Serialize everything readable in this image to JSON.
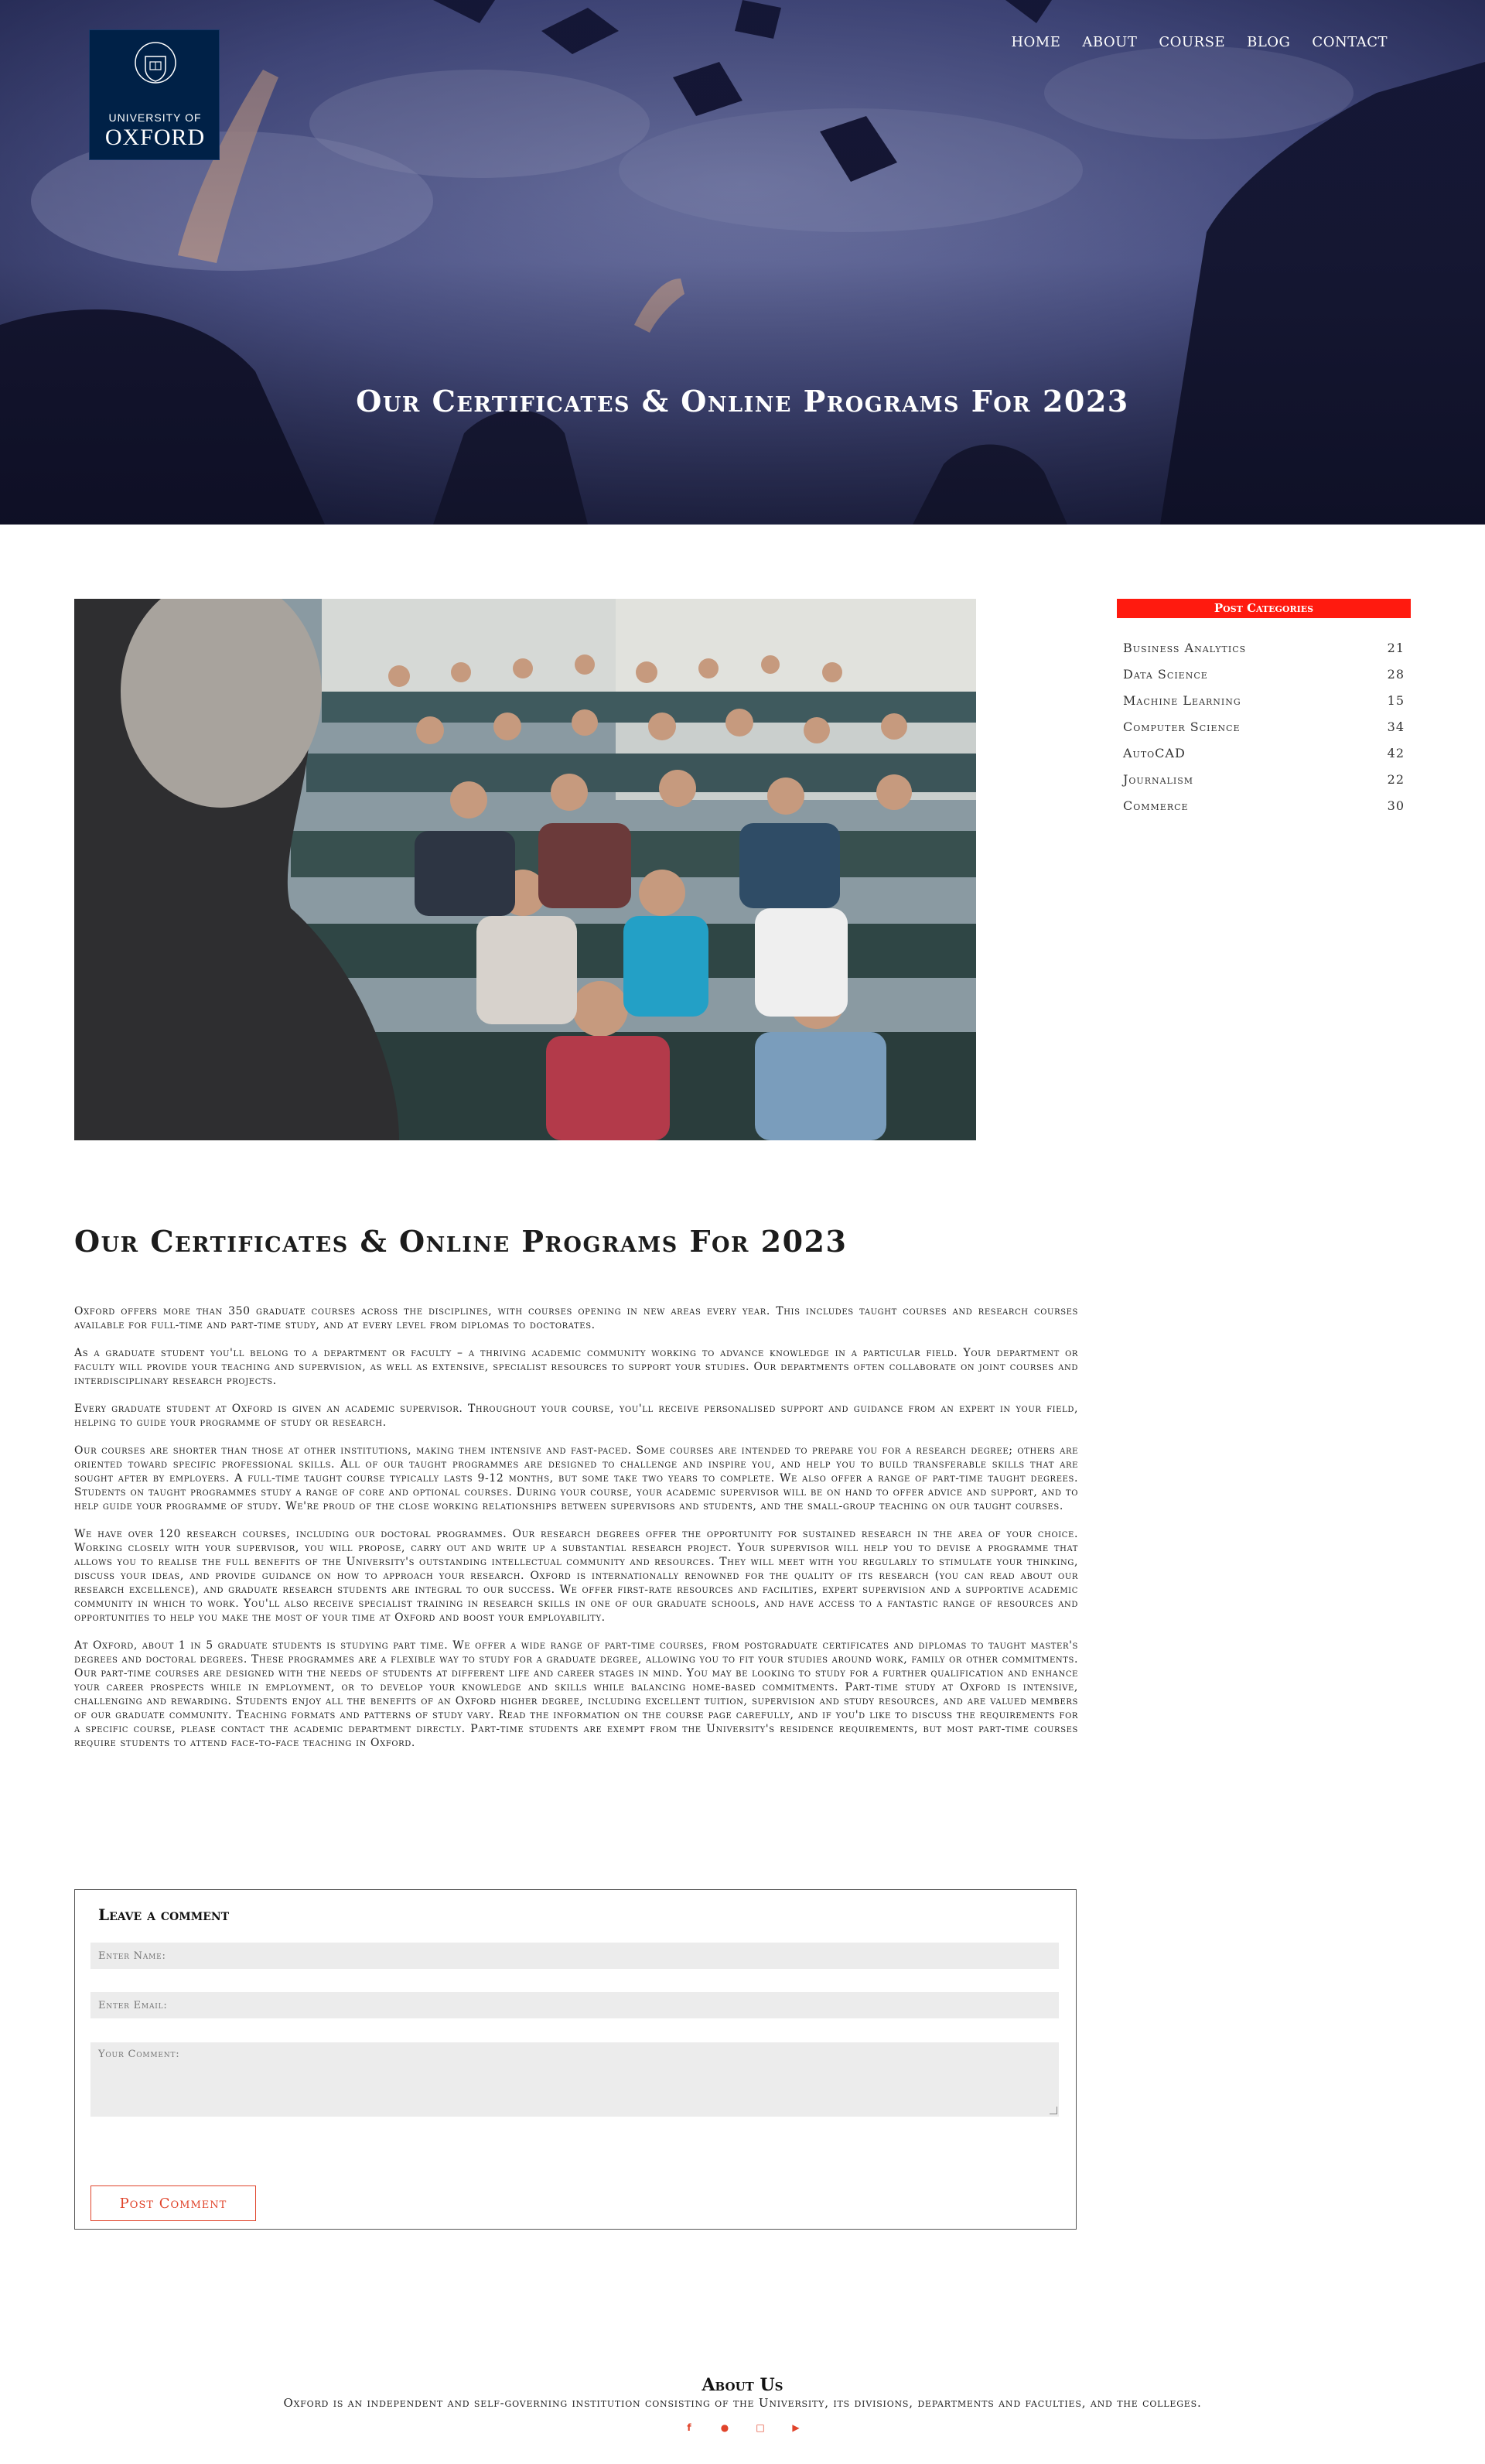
{
  "logo": {
    "line1": "UNIVERSITY OF",
    "line2": "OXFORD"
  },
  "nav": {
    "items": [
      {
        "label": "HOME"
      },
      {
        "label": "ABOUT"
      },
      {
        "label": "COURSE"
      },
      {
        "label": "BLOG"
      },
      {
        "label": "CONTACT"
      }
    ]
  },
  "hero": {
    "title": "Our Certificates & Online Programs For 2023"
  },
  "article": {
    "title": "Our Certificates & Online Programs For 2023",
    "paragraphs": [
      "Oxford offers more than 350 graduate courses across the disciplines, with courses opening in new areas every year. This includes taught courses and research courses available for full-time and part-time study, and at every level from diplomas to doctorates.",
      "As a graduate student you'll belong to a department or faculty – a thriving academic community working to advance knowledge in a particular field. Your department or faculty will provide your teaching and supervision, as well as extensive, specialist resources to support your studies. Our departments often collaborate on joint courses and interdisciplinary research projects.",
      "Every graduate student at Oxford is given an academic supervisor. Throughout your course, you'll receive personalised support and guidance from an expert in your field, helping to guide your programme of study or research.",
      "Our courses are shorter than those at other institutions, making them intensive and fast-paced. Some courses are intended to prepare you for a research degree; others are oriented toward specific professional skills. All of our taught programmes are designed to challenge and inspire you, and help you to build transferable skills that are sought after by employers. A full-time taught course typically lasts 9-12 months, but some take two years to complete. We also offer a range of part-time taught degrees. Students on taught programmes study a range of core and optional courses. During your course, your academic supervisor will be on hand to offer advice and support, and to help guide your programme of study. We're proud of the close working relationships between supervisors and students, and the small-group teaching on our taught courses.",
      "We have over 120 research courses, including our doctoral programmes. Our research degrees offer the opportunity for sustained research in the area of your choice. Working closely with your supervisor, you will propose, carry out and write up a substantial research project. Your supervisor will help you to devise a programme that allows you to realise the full benefits of the University's outstanding intellectual community and resources. They will meet with you regularly to stimulate your thinking, discuss your ideas, and provide guidance on how to approach your research. Oxford is internationally renowned for the quality of its research (you can read about our research excellence), and graduate research students are integral to our success. We offer first-rate resources and facilities, expert supervision and a supportive academic community in which to work. You'll also receive specialist training in research skills in one of our graduate schools, and have access to a fantastic range of resources and opportunities to help you make the most of your time at Oxford and boost your employability.",
      "At Oxford, about 1 in 5 graduate students is studying part time. We offer a wide range of part-time courses, from postgraduate certificates and diplomas to taught master's degrees and doctoral degrees. These programmes are a flexible way to study for a graduate degree, allowing you to fit your studies around work, family or other commitments. Our part-time courses are designed with the needs of students at different life and career stages in mind. You may be looking to study for a further qualification and enhance your career prospects while in employment, or to develop your knowledge and skills while balancing home-based commitments. Part-time study at Oxford is intensive, challenging and rewarding. Students enjoy all the benefits of an Oxford higher degree, including excellent tuition, supervision and study resources, and are valued members of our graduate community. Teaching formats and patterns of study vary. Read the information on the course page carefully, and if you'd like to discuss the requirements for a specific course, please contact the academic department directly. Part-time students are exempt from the University's residence requirements, but most part-time courses require students to attend face-to-face teaching in Oxford."
    ]
  },
  "sidebar": {
    "header": "Post Categories",
    "categories": [
      {
        "name": "Business Analytics",
        "count": "21"
      },
      {
        "name": "Data Science",
        "count": "28"
      },
      {
        "name": "Machine Learning",
        "count": "15"
      },
      {
        "name": "Computer Science",
        "count": "34"
      },
      {
        "name": "AutoCAD",
        "count": "42"
      },
      {
        "name": "Journalism",
        "count": "22"
      },
      {
        "name": "Commerce",
        "count": "30"
      }
    ]
  },
  "comment": {
    "title": "Leave a comment",
    "name_placeholder": "Enter Name:",
    "email_placeholder": "Enter Email:",
    "comment_placeholder": "Your Comment:",
    "button": "Post Comment"
  },
  "footer": {
    "title": "About Us",
    "text": "Oxford is an independent and self-governing institution consisting of the University, its divisions, departments and faculties, and the colleges.",
    "socials": [
      "facebook-icon",
      "twitter-icon",
      "instagram-icon",
      "youtube-icon"
    ]
  },
  "colors": {
    "accent": "#ff1a0f",
    "logo_blue": "#002147",
    "button_red": "#e0442b"
  }
}
